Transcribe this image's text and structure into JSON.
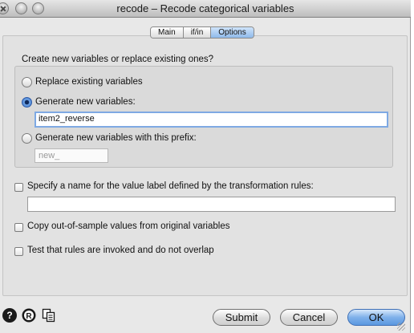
{
  "window": {
    "title": "recode – Recode categorical variables"
  },
  "tabs": [
    {
      "label": "Main",
      "active": false
    },
    {
      "label": "if/in",
      "active": false
    },
    {
      "label": "Options",
      "active": true
    }
  ],
  "options": {
    "group_label": "Create new variables or replace existing ones?",
    "replace_label": "Replace existing variables",
    "generate_label": "Generate new variables:",
    "generate_value": "item2_reverse",
    "prefix_label": "Generate new variables with this prefix:",
    "prefix_value": "new_",
    "selected": "generate",
    "value_label_check": "Specify a name for the value label defined by the transformation rules:",
    "value_label_value": "",
    "copy_check": "Copy out-of-sample values from original variables",
    "test_check": "Test that rules are invoked and do not overlap"
  },
  "footer": {
    "help_glyph": "?",
    "reset_glyph": "R",
    "submit_label": "Submit",
    "cancel_label": "Cancel",
    "ok_label": "OK"
  },
  "colors": {
    "accent": "#5b98e0",
    "focus": "#7ea9e3"
  }
}
